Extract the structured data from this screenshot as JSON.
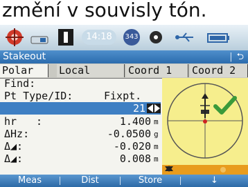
{
  "caption": "změní v souvisly tón.",
  "status_bar": {
    "time": "14:18",
    "satellites": "343"
  },
  "window": {
    "title": "Stakeout",
    "back_glyph": "⮌"
  },
  "tabs": [
    {
      "label": "Polar"
    },
    {
      "label": "Local"
    },
    {
      "label": "Coord 1"
    },
    {
      "label": "Coord 2"
    }
  ],
  "fields": {
    "find_label": "Find:",
    "pt_type_label": "Pt Type/ID:",
    "pt_type_value": "Fixpt.",
    "pt_number": "21",
    "hr_label": "hr",
    "hr_sep": ":",
    "hr_value": "1.400",
    "hr_unit": "m",
    "dhz_label": "ΔHz:",
    "dhz_value": "-0.0500",
    "dhz_unit": "g",
    "d2_label": "Δ◢:",
    "d2_value": "-0.020",
    "d2_unit": "m",
    "d3_label": "Δ◢:",
    "d3_value": "0.008",
    "d3_unit": "m"
  },
  "softkeys": [
    {
      "label": "Meas"
    },
    {
      "label": "Dist"
    },
    {
      "label": "Store"
    },
    {
      "label": "↓"
    }
  ],
  "colors": {
    "title_blue": "#2b6cad",
    "highlight_blue": "#3e7fc3",
    "graphic_yellow": "#f6ee8d",
    "check_green": "#3a9a3a"
  }
}
